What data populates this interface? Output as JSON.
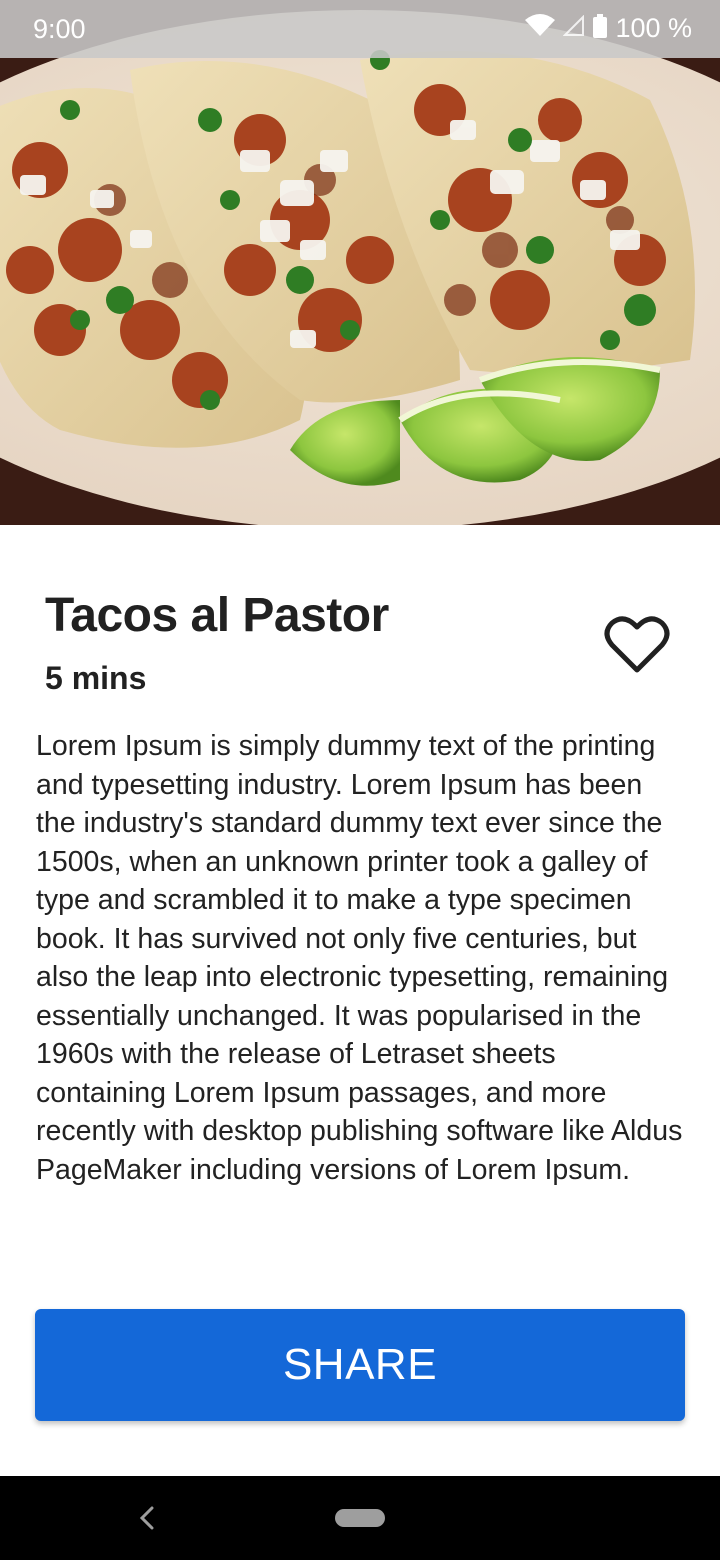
{
  "status_bar": {
    "time": "9:00",
    "battery_percent": "100 %",
    "icons": [
      "wifi-icon",
      "signal-icon",
      "battery-icon"
    ]
  },
  "hero": {
    "image": "tacos-photo"
  },
  "recipe": {
    "title": "Tacos al Pastor",
    "duration": "5 mins",
    "favorite_icon": "heart-outline-icon",
    "description": "Lorem Ipsum is simply dummy text of the printing and typesetting industry. Lorem Ipsum has been the industry's standard dummy text ever since the 1500s, when an unknown printer took a galley of type and scrambled it to make a type specimen book. It has survived not only five centuries, but also the leap into electronic typesetting, remaining essentially unchanged. It was popularised in the 1960s with the release of Letraset sheets containing Lorem Ipsum passages, and more recently with desktop publishing software like Aldus PageMaker including versions of Lorem Ipsum."
  },
  "actions": {
    "share_label": "SHARE"
  },
  "nav_bar": {
    "icons": [
      "back-icon",
      "home-pill-icon"
    ]
  },
  "colors": {
    "accent": "#1468d8",
    "text": "#212121",
    "nav_background": "#000000"
  }
}
